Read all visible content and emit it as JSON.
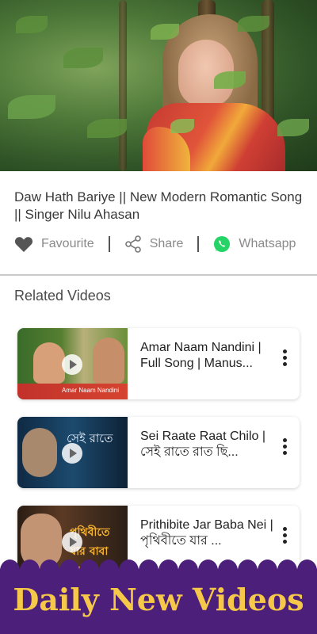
{
  "video": {
    "title": "Daw Hath Bariye || New Modern Romantic Song || Singer Nilu Ahasan"
  },
  "actions": {
    "favourite_label": "Favourite",
    "share_label": "Share",
    "whatsapp_label": "Whatsapp"
  },
  "related": {
    "heading": "Related Videos",
    "items": [
      {
        "title": "Amar Naam Nandini | Full Song | Manus...",
        "thumb_caption": "Amar Naam Nandini"
      },
      {
        "title": "Sei Raate Raat Chilo | সেই রাতে রাত ছি...",
        "thumb_caption": "সেই রাতে"
      },
      {
        "title": "Prithibite Jar Baba Nei | পৃথিবীতে যার ...",
        "thumb_caption": "পৃথিবীতে যার বাবা নেই"
      }
    ]
  },
  "banner": {
    "text": "Daily New Videos"
  },
  "colors": {
    "whatsapp": "#25d366",
    "banner_bg": "#4b1f7a",
    "banner_text": "#f6c84a"
  }
}
